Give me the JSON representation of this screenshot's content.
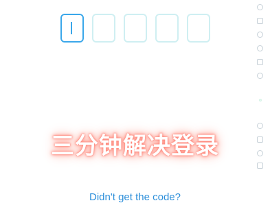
{
  "otp": {
    "box_count": 5,
    "active_index": 0,
    "active_color": "#3aa7ea",
    "inactive_color": "#cfeff2"
  },
  "side_rail": {
    "icons": [
      "emoji-icon",
      "emoji-icon",
      "emoji-icon",
      "emoji-icon",
      "emoji-icon",
      "emoji-icon",
      "dot-icon",
      "emoji-icon",
      "emoji-icon",
      "emoji-icon",
      "emoji-icon"
    ]
  },
  "watermark": {
    "text": "三分钟解决登录",
    "glow_color": "#ff8a7d"
  },
  "resend": {
    "label": "Didn't get the code?",
    "color": "#2d8fda"
  }
}
